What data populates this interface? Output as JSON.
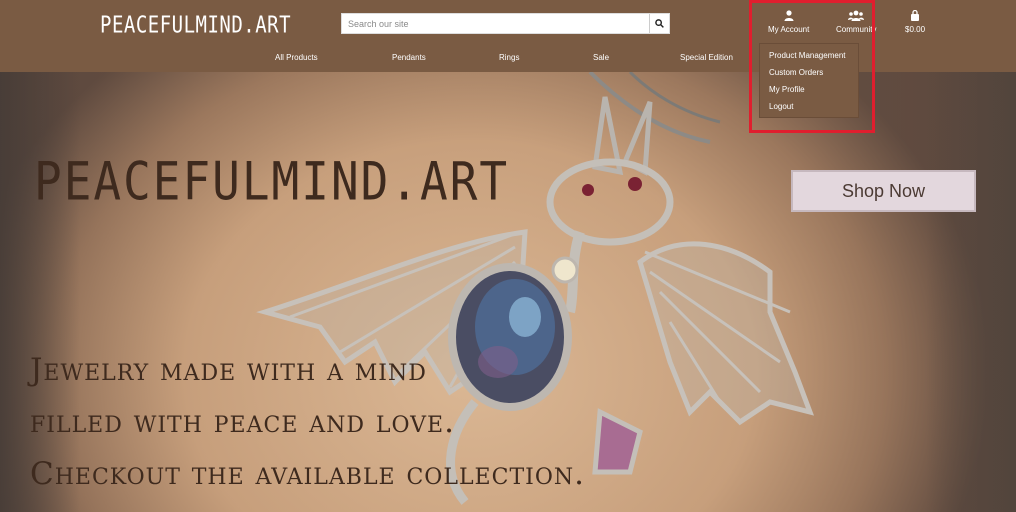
{
  "header": {
    "logo": "PEACEFULMIND.ART",
    "search": {
      "placeholder": "Search our site",
      "value": ""
    },
    "nav": [
      {
        "label": "All Products"
      },
      {
        "label": "Pendants"
      },
      {
        "label": "Rings"
      },
      {
        "label": "Sale"
      },
      {
        "label": "Special Edition"
      }
    ],
    "account_label": "My Account",
    "community_label": "Community",
    "cart_total": "$0.00"
  },
  "dropdown": {
    "items": [
      "Product Management",
      "Custom Orders",
      "My Profile",
      "Logout"
    ]
  },
  "hero": {
    "title": "PEACEFULMIND.ART",
    "lines": [
      "Jewelry made with a mind",
      "filled with peace and love.",
      "Checkout the available collection."
    ],
    "cta_label": "Shop Now"
  },
  "colors": {
    "header_bg": "#7a5b43",
    "highlight": "#e01e2e",
    "cta_bg": "#e3d7dd",
    "hero_text": "#3e2a1e"
  },
  "icons": [
    "search-icon",
    "user-icon",
    "users-icon",
    "shopping-bag-icon"
  ]
}
